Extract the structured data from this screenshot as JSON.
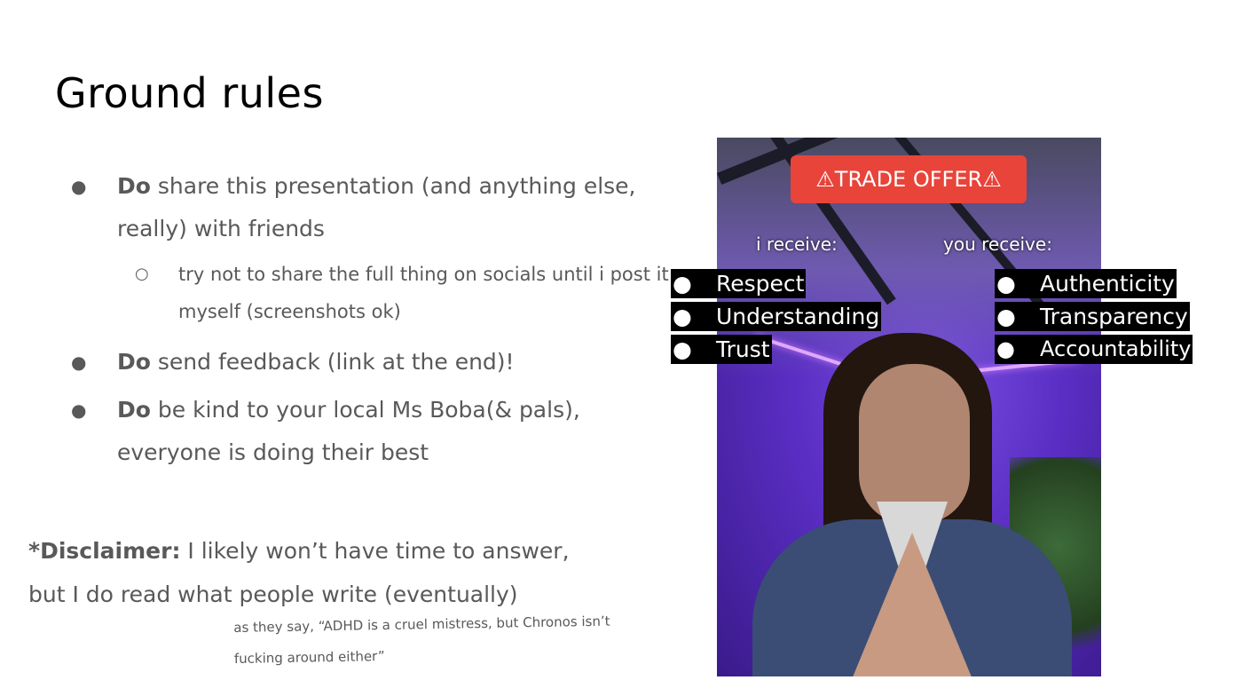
{
  "slide": {
    "title": "Ground rules",
    "bullets": [
      {
        "bold": "Do",
        "text": " share this presentation (and anything else, really) with friends"
      },
      {
        "bold": "Do",
        "text": " send feedback (link at the end)!"
      },
      {
        "bold": "Do",
        "text": " be kind to your local Ms Boba(& pals), everyone is doing their best"
      }
    ],
    "sub_bullet": "try not to share the full thing on socials until i post it myself (screenshots ok)",
    "bullet_char": "●",
    "sub_bullet_char": "○",
    "disclaimer": {
      "bold": "*Disclaimer:",
      "text": " I likely won’t have time to answer, but I do read what people write (eventually)"
    },
    "quote": "as they say, “ADHD is a cruel mistress, but Chronos isn’t fucking around either”"
  },
  "meme": {
    "banner": "⚠TRADE OFFER⚠",
    "i_receive_label": "i receive:",
    "you_receive_label": "you receive:",
    "i_receive": [
      "Respect",
      "Understanding",
      "Trust"
    ],
    "you_receive": [
      "Authenticity",
      "Transparency",
      "Accountability"
    ],
    "list_bullet": "●"
  },
  "colors": {
    "text": "#595959",
    "title": "#000000",
    "banner": "#e8443a",
    "purple": "#5a2ec4"
  }
}
